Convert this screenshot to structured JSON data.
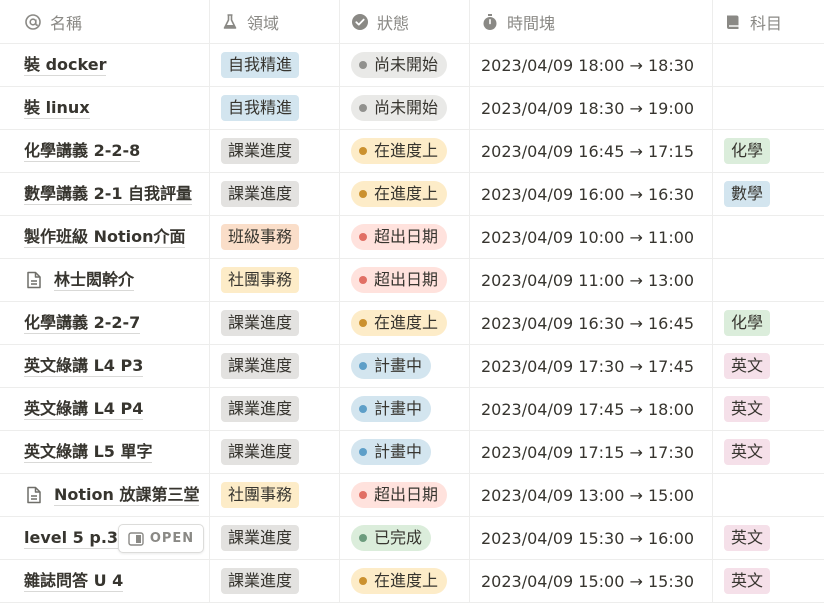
{
  "header": {
    "name": "名稱",
    "area": "領域",
    "status": "狀態",
    "time": "時間塊",
    "subject": "科目"
  },
  "colors": {
    "自我精進": "#d3e5ef",
    "課業進度": "#e3e2e0",
    "班級事務": "#fadec9",
    "社團事務": "#fdecc8"
  },
  "open_label": "OPEN",
  "rows": [
    {
      "name": "裝 docker",
      "page_icon": false,
      "area": "自我精進",
      "area_color": "blue",
      "status": "尚未開始",
      "status_color": "gray",
      "time": "2023/04/09 18:00 → 18:30",
      "subject": "",
      "subject_color": ""
    },
    {
      "name": "裝 linux",
      "page_icon": false,
      "area": "自我精進",
      "area_color": "blue",
      "status": "尚未開始",
      "status_color": "gray",
      "time": "2023/04/09 18:30 → 19:00",
      "subject": "",
      "subject_color": ""
    },
    {
      "name": "化學講義 2-2-8",
      "page_icon": false,
      "area": "課業進度",
      "area_color": "gray",
      "status": "在進度上",
      "status_color": "yellow",
      "time": "2023/04/09 16:45 → 17:15",
      "subject": "化學",
      "subject_color": "green"
    },
    {
      "name": "數學講義 2-1 自我評量",
      "page_icon": false,
      "area": "課業進度",
      "area_color": "gray",
      "status": "在進度上",
      "status_color": "yellow",
      "time": "2023/04/09 16:00 → 16:30",
      "subject": "數學",
      "subject_color": "blue"
    },
    {
      "name": "製作班級 Notion介面",
      "page_icon": false,
      "area": "班級事務",
      "area_color": "orange",
      "status": "超出日期",
      "status_color": "red",
      "time": "2023/04/09 10:00 → 11:00",
      "subject": "",
      "subject_color": ""
    },
    {
      "name": "林士閎幹介",
      "page_icon": true,
      "area": "社團事務",
      "area_color": "yellow",
      "status": "超出日期",
      "status_color": "red",
      "time": "2023/04/09 11:00 → 13:00",
      "subject": "",
      "subject_color": ""
    },
    {
      "name": "化學講義 2-2-7",
      "page_icon": false,
      "area": "課業進度",
      "area_color": "gray",
      "status": "在進度上",
      "status_color": "yellow",
      "time": "2023/04/09 16:30 → 16:45",
      "subject": "化學",
      "subject_color": "green"
    },
    {
      "name": "英文綠講 L4 P3",
      "page_icon": false,
      "area": "課業進度",
      "area_color": "gray",
      "status": "計畫中",
      "status_color": "blue",
      "time": "2023/04/09 17:30 → 17:45",
      "subject": "英文",
      "subject_color": "pink"
    },
    {
      "name": "英文綠講 L4 P4",
      "page_icon": false,
      "area": "課業進度",
      "area_color": "gray",
      "status": "計畫中",
      "status_color": "blue",
      "time": "2023/04/09 17:45 → 18:00",
      "subject": "英文",
      "subject_color": "pink"
    },
    {
      "name": "英文綠講 L5 單字",
      "page_icon": false,
      "area": "課業進度",
      "area_color": "gray",
      "status": "計畫中",
      "status_color": "blue",
      "time": "2023/04/09 17:15 → 17:30",
      "subject": "英文",
      "subject_color": "pink"
    },
    {
      "name": "Notion 放課第三堂",
      "page_icon": true,
      "area": "社團事務",
      "area_color": "yellow",
      "status": "超出日期",
      "status_color": "red",
      "time": "2023/04/09 13:00 → 15:00",
      "subject": "",
      "subject_color": ""
    },
    {
      "name": "level 5 p.34",
      "page_icon": false,
      "area": "課業進度",
      "area_color": "gray",
      "status": "已完成",
      "status_color": "green",
      "time": "2023/04/09 15:30 → 16:00",
      "subject": "英文",
      "subject_color": "pink",
      "hover_open": true
    },
    {
      "name": "雜誌問答 U 4",
      "page_icon": false,
      "area": "課業進度",
      "area_color": "gray",
      "status": "在進度上",
      "status_color": "yellow",
      "time": "2023/04/09 15:00 → 15:30",
      "subject": "英文",
      "subject_color": "pink"
    }
  ]
}
